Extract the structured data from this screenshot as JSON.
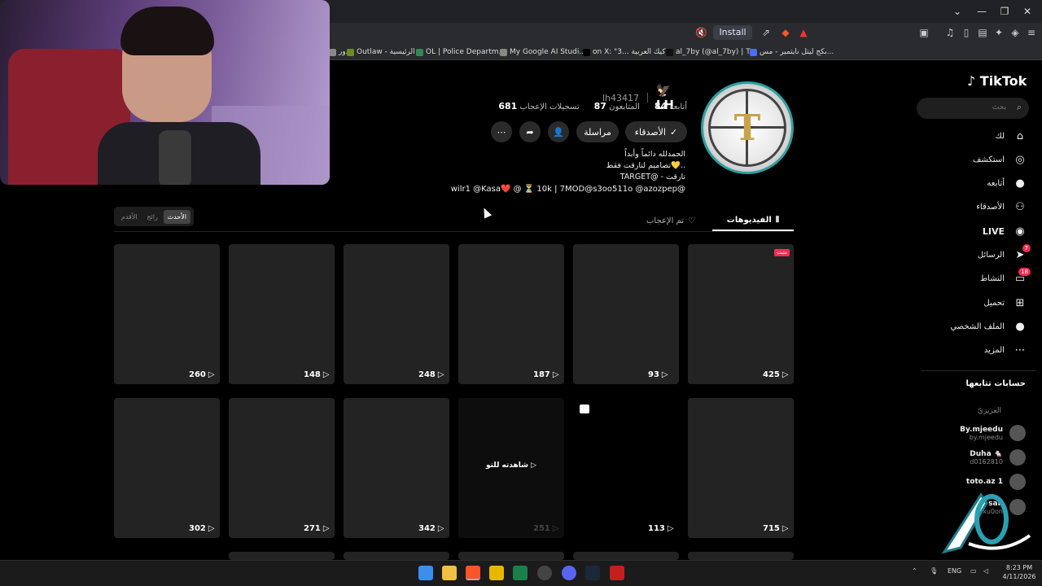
{
  "browser": {
    "install_label": "Install",
    "bookmarks": [
      {
        "label": "دور",
        "color": "#888"
      },
      {
        "label": "Outlaw - الرئيسية",
        "color": "#6b8e23"
      },
      {
        "label": "OL | Police Departm...",
        "color": "#2e8b57"
      },
      {
        "label": "My Google AI Studi...",
        "color": "#888"
      },
      {
        "label": "on X: \"3...  كيك العربية",
        "color": "#000"
      },
      {
        "label": "al_7by (@al_7by) | T...",
        "color": "#111"
      },
      {
        "label": "بكج ليتل نايتمير - مس...",
        "color": "#4a6cf7"
      }
    ]
  },
  "sidebar": {
    "logo": "TikTok",
    "search_placeholder": "بحث",
    "items": [
      {
        "label": "لك",
        "icon": "home-icon",
        "glyph": "⌂"
      },
      {
        "label": "استكشف",
        "icon": "compass-icon",
        "glyph": "◎"
      },
      {
        "label": "أتابعه",
        "icon": "avatar-icon",
        "glyph": "●"
      },
      {
        "label": "الأصدقاء",
        "icon": "friends-icon",
        "glyph": "⚇"
      },
      {
        "label": "LIVE",
        "icon": "live-icon",
        "glyph": "◉"
      },
      {
        "label": "الرسائل",
        "icon": "messages-icon",
        "glyph": "➤",
        "badge": "7"
      },
      {
        "label": "النشاط",
        "icon": "activity-icon",
        "glyph": "▭",
        "badge": "18"
      },
      {
        "label": "تحميل",
        "icon": "upload-icon",
        "glyph": "⊞"
      },
      {
        "label": "الملف الشخصي",
        "icon": "profile-icon",
        "glyph": "●"
      },
      {
        "label": "المزيد",
        "icon": "more-icon",
        "glyph": "⋯"
      }
    ],
    "following_heading": "حسابات تتابعها",
    "following_sub": "العزيزيّ",
    "accounts": [
      {
        "name": "By.mjeedu",
        "handle": "by.mjeedu"
      },
      {
        "name": "Duha 🐁",
        "handle": "d0162810"
      },
      {
        "name": "toto.az 1",
        "handle": ""
      },
      {
        "name": "san",
        "handle": "xu0on"
      }
    ]
  },
  "profile": {
    "nickname": "LH",
    "handle": "lh43417",
    "following_label": "أتابعه",
    "following_count": "84",
    "followers_label": "المتابعون",
    "followers_count": "87",
    "likes_label": "تسجيلات الإعجاب",
    "likes_count": "681",
    "friends_button": "الأصدقاء",
    "message_button": "مراسلة",
    "bio": [
      "الحمدلله دائماً وأبداً",
      "تصاميم لتارقت فقط💛..",
      "TARGET@ - تارقت",
      "wilr1 @Kasa❤️ @ ⏳ 10k | 7MOD@s3oo511o @azozpep@"
    ]
  },
  "tabs": {
    "videos": "الفيديوهات",
    "liked": "تم الإعجاب",
    "sort": [
      "الأقدم",
      "رائج",
      "الأحدث"
    ]
  },
  "videos": [
    {
      "views": "260",
      "pinned": false
    },
    {
      "views": "148",
      "pinned": false
    },
    {
      "views": "248",
      "pinned": false
    },
    {
      "views": "187",
      "pinned": false
    },
    {
      "views": "93",
      "pinned": false
    },
    {
      "views": "425",
      "pinned": true,
      "pin_label": "مثبت"
    },
    {
      "views": "302"
    },
    {
      "views": "271"
    },
    {
      "views": "342"
    },
    {
      "views": "251",
      "overlay": "شاهدته للتو"
    },
    {
      "views": "113",
      "photo": true
    },
    {
      "views": "715"
    }
  ],
  "taskbar": {
    "lang": "ENG",
    "time": "8:23 PM",
    "date": "4/11/2026"
  }
}
